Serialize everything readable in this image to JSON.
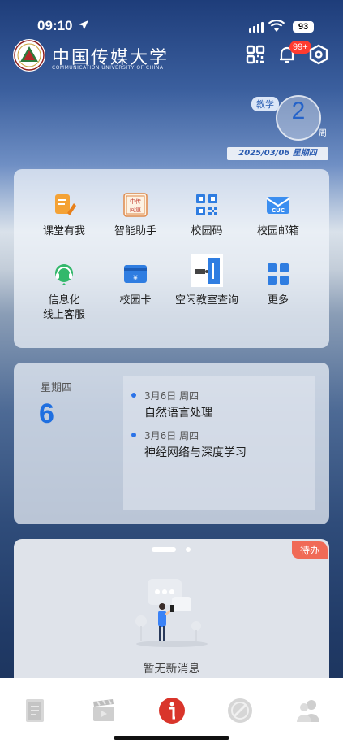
{
  "status_bar": {
    "time": "09:10",
    "battery": "93"
  },
  "header": {
    "university_name": "中国传媒大学",
    "university_subtitle": "COMMUNICATION UNIVERSITY OF CHINA",
    "notification_badge": "99+"
  },
  "week": {
    "tag": "教学",
    "number": "2",
    "unit": "周",
    "date": "2025/03/06 星期四"
  },
  "quick_apps": [
    {
      "label": "课堂有我",
      "icon": "classroom-icon"
    },
    {
      "label": "智能助手",
      "icon": "assistant-icon"
    },
    {
      "label": "校园码",
      "icon": "qr-code-icon"
    },
    {
      "label": "校园邮箱",
      "icon": "mail-icon"
    },
    {
      "label": "信息化线上客服",
      "line1": "信息化",
      "line2": "线上客服",
      "icon": "headset-icon"
    },
    {
      "label": "校园卡",
      "icon": "campus-card-icon"
    },
    {
      "label": "空闲教室查询",
      "icon": "classroom-search-icon"
    },
    {
      "label": "更多",
      "icon": "grid-more-icon"
    }
  ],
  "schedule": {
    "weekday": "星期四",
    "day": "6",
    "events": [
      {
        "date": "3月6日 周四",
        "title": "自然语言处理"
      },
      {
        "date": "3月6日 周四",
        "title": "神经网络与深度学习"
      }
    ]
  },
  "messages": {
    "todo_label": "待办",
    "empty_text": "暂无新消息"
  },
  "tabs": [
    {
      "icon": "document-icon"
    },
    {
      "icon": "clapperboard-icon"
    },
    {
      "icon": "info-icon",
      "active": true
    },
    {
      "icon": "compass-icon"
    },
    {
      "icon": "people-icon"
    }
  ],
  "colors": {
    "accent": "#1f6fe0",
    "tab_active": "#d9352b",
    "todo_badge": "#f06a56"
  }
}
